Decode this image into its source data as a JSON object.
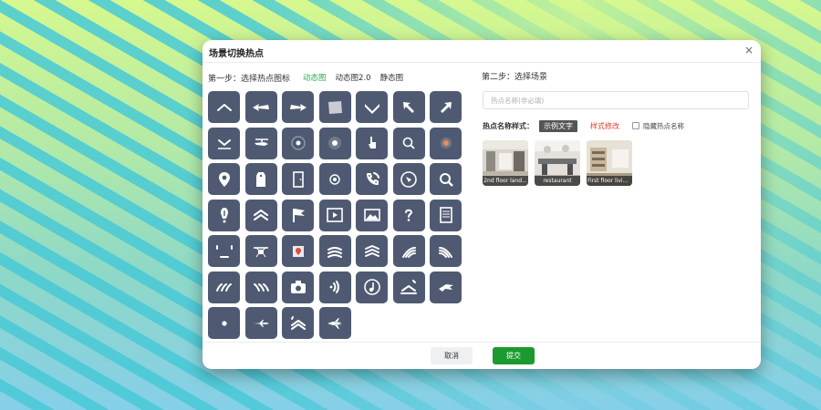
{
  "modal": {
    "title": "场景切换热点",
    "close_symbol": "×"
  },
  "step1": {
    "label": "第一步：选择热点图标",
    "tabs": [
      {
        "label": "动态图",
        "active": true
      },
      {
        "label": "动态图2.0",
        "active": false
      },
      {
        "label": "静态图",
        "active": false
      }
    ],
    "icons": [
      "chevron-up-icon",
      "arrow-left-icon",
      "arrow-right-icon",
      "square-plane-icon",
      "chevron-down-icon",
      "arrow-upleft-icon",
      "arrow-upright-icon",
      "chevron-down-line-icon",
      "helicopter-icon",
      "target-ring-icon",
      "target-dot-icon",
      "hand-pointer-icon",
      "magnifier-dot-icon",
      "record-dot-icon",
      "map-pin-icon",
      "tag-icon",
      "door-icon",
      "radio-dot-icon",
      "phone-ring-icon",
      "compass-icon",
      "search-icon",
      "info-icon",
      "double-chevron-up-icon",
      "flag-icon",
      "film-icon",
      "picture-icon",
      "question-icon",
      "document-icon",
      "face-corners-icon",
      "drone-icon",
      "location-card-icon",
      "stacked-arrows-icon",
      "stacked-arrows-b-icon",
      "wave-arrows-icon",
      "wave-arrows-b-icon",
      "speed-arrows-icon",
      "speed-arrows-b-icon",
      "camera-icon",
      "sound-waves-icon",
      "music-note-icon",
      "chevron-corners-icon",
      "fighter-jet-icon",
      "small-dot-icon",
      "airplane-icon",
      "double-chevron-corners-icon",
      "jet-left-icon"
    ]
  },
  "step2": {
    "label": "第二步：选择场景",
    "name_placeholder": "热点名称(非必填)",
    "name_value": "",
    "style_label": "热点名称样式：",
    "sample_text": "示例文字",
    "style_edit": "样式修改",
    "hide_label": "隐藏热点名称",
    "scenes": [
      {
        "name": "2nd floor land..."
      },
      {
        "name": "restaurant"
      },
      {
        "name": "First floor livin..."
      }
    ]
  },
  "footer": {
    "cancel": "取消",
    "submit": "提交"
  },
  "colors": {
    "accent": "#2ba84a",
    "submit": "#1d9a2f",
    "icon_tile": "#4f5a72",
    "style_edit": "#e03c2a"
  }
}
